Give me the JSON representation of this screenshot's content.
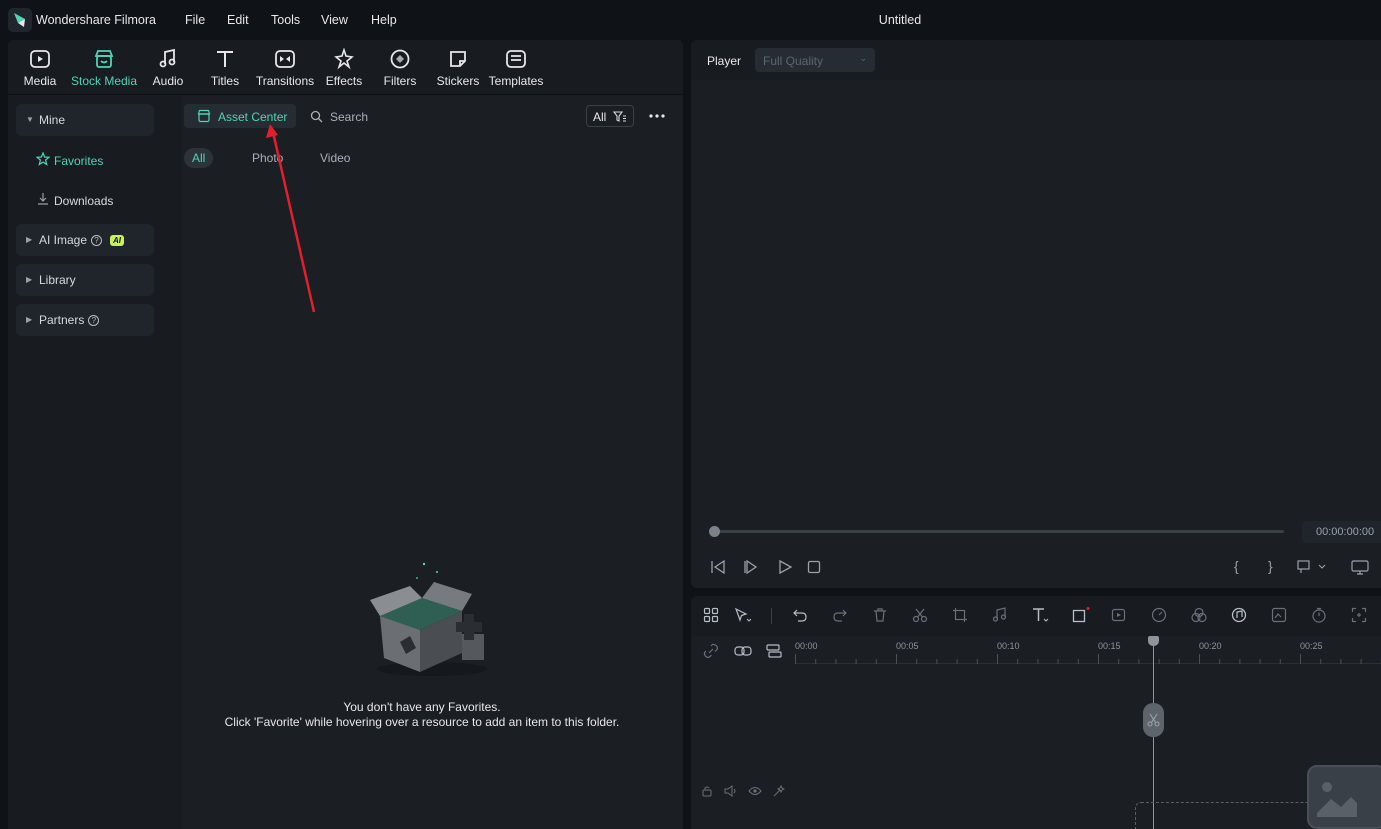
{
  "app": {
    "name": "Wondershare Filmora",
    "window_title": "Untitled"
  },
  "menu": [
    "File",
    "Edit",
    "Tools",
    "View",
    "Help"
  ],
  "toolbar": {
    "tabs": [
      {
        "label": "Media",
        "icon": "media-icon"
      },
      {
        "label": "Stock Media",
        "icon": "stock-media-icon",
        "active": true
      },
      {
        "label": "Audio",
        "icon": "audio-icon"
      },
      {
        "label": "Titles",
        "icon": "titles-icon"
      },
      {
        "label": "Transitions",
        "icon": "transitions-icon"
      },
      {
        "label": "Effects",
        "icon": "effects-icon"
      },
      {
        "label": "Filters",
        "icon": "filters-icon"
      },
      {
        "label": "Stickers",
        "icon": "stickers-icon"
      },
      {
        "label": "Templates",
        "icon": "templates-icon"
      }
    ]
  },
  "sidebar": {
    "mine": "Mine",
    "favorites": "Favorites",
    "downloads": "Downloads",
    "ai_image": "AI Image",
    "ai_badge": "AI",
    "library": "Library",
    "partners": "Partners"
  },
  "content": {
    "asset_center": "Asset Center",
    "search": "Search",
    "filter": "All",
    "chips": [
      "All",
      "Photo",
      "Video"
    ],
    "empty_title": "You don't have any Favorites.",
    "empty_sub": "Click 'Favorite' while hovering over a resource to add an item to this folder."
  },
  "player": {
    "label": "Player",
    "quality": "Full Quality",
    "timecode": "00:00:00:00"
  },
  "timeline": {
    "ticks": [
      "00:00",
      "00:05",
      "00:10",
      "00:15",
      "00:20",
      "00:25"
    ]
  },
  "colors": {
    "accent": "#4fd6b4",
    "panel": "#1b1f24",
    "background": "#0f1216",
    "annotation": "#e0202b"
  }
}
